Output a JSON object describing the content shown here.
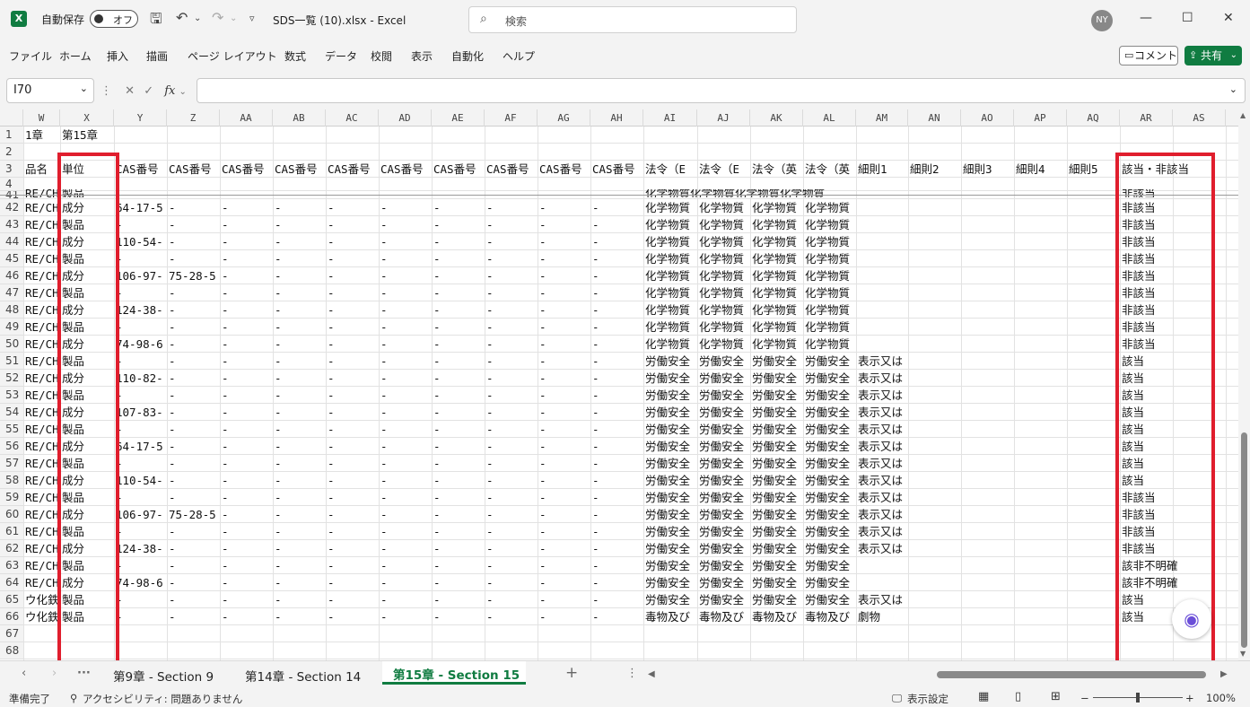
{
  "titlebar": {
    "app_icon": "X",
    "autosave_label": "自動保存",
    "autosave_state": "オフ",
    "doc_title": "SDS一覧 (10).xlsx  -  Excel",
    "search_placeholder": "検索",
    "avatar": "NY"
  },
  "ribbon": {
    "menu": [
      "ファイル",
      "ホーム",
      "挿入",
      "描画",
      "ページ レイアウト",
      "数式",
      "データ",
      "校閲",
      "表示",
      "自動化",
      "ヘルプ"
    ],
    "comment_label": "コメント",
    "share_label": "共有"
  },
  "formulabar": {
    "namebox": "I70",
    "fx": "fx",
    "value": ""
  },
  "grid": {
    "columns": [
      "W",
      "X",
      "Y",
      "Z",
      "AA",
      "AB",
      "AC",
      "AD",
      "AE",
      "AF",
      "AG",
      "AH",
      "AI",
      "AJ",
      "AK",
      "AL",
      "AM",
      "AN",
      "AO",
      "AP",
      "AQ",
      "AR",
      "AS"
    ],
    "row_numbers": [
      "1",
      "2",
      "3",
      "4",
      "41",
      "42",
      "43",
      "44",
      "45",
      "46",
      "47",
      "48",
      "49",
      "50",
      "51",
      "52",
      "53",
      "54",
      "55",
      "56",
      "57",
      "58",
      "59",
      "60",
      "61",
      "62",
      "63",
      "64",
      "65",
      "66",
      "67",
      "68"
    ],
    "row1": {
      "W": "1章",
      "X": "第15章"
    },
    "row3": [
      "品名",
      "単位",
      "CAS番号",
      "CAS番号",
      "CAS番号",
      "CAS番号",
      "CAS番号",
      "CAS番号",
      "CAS番号",
      "CAS番号",
      "CAS番号",
      "CAS番号",
      "法令（E",
      "法令（E",
      "法令（英",
      "法令（英",
      "細則1",
      "細則2",
      "細則3",
      "細則4",
      "細則5",
      "該当・非該当",
      ""
    ],
    "partial_row41": {
      "W": "RE/CH",
      "X": "製品",
      "AI": "化学物質化学物質化学物質化学物質",
      "AR": "非該当"
    },
    "rows": [
      {
        "W": "RE/CH",
        "X": "成分",
        "Y": "64-17-5",
        "Z": "-",
        "AI": "化学物質",
        "AJ": "化学物質",
        "AK": "化学物質",
        "AL": "化学物質",
        "AM": "",
        "AR": "非該当"
      },
      {
        "W": "RE/CH",
        "X": "製品",
        "Y": "-",
        "Z": "-",
        "AI": "化学物質",
        "AJ": "化学物質",
        "AK": "化学物質",
        "AL": "化学物質",
        "AM": "",
        "AR": "非該当"
      },
      {
        "W": "RE/CH",
        "X": "成分",
        "Y": "110-54-",
        "Z": "-",
        "AI": "化学物質",
        "AJ": "化学物質",
        "AK": "化学物質",
        "AL": "化学物質",
        "AM": "",
        "AR": "非該当"
      },
      {
        "W": "RE/CH",
        "X": "製品",
        "Y": "-",
        "Z": "-",
        "AI": "化学物質",
        "AJ": "化学物質",
        "AK": "化学物質",
        "AL": "化学物質",
        "AM": "",
        "AR": "非該当"
      },
      {
        "W": "RE/CH",
        "X": "成分",
        "Y": "106-97-",
        "Z": "75-28-5",
        "AI": "化学物質",
        "AJ": "化学物質",
        "AK": "化学物質",
        "AL": "化学物質",
        "AM": "",
        "AR": "非該当"
      },
      {
        "W": "RE/CH",
        "X": "製品",
        "Y": "-",
        "Z": "-",
        "AI": "化学物質",
        "AJ": "化学物質",
        "AK": "化学物質",
        "AL": "化学物質",
        "AM": "",
        "AR": "非該当"
      },
      {
        "W": "RE/CH",
        "X": "成分",
        "Y": "124-38-",
        "Z": "-",
        "AI": "化学物質",
        "AJ": "化学物質",
        "AK": "化学物質",
        "AL": "化学物質",
        "AM": "",
        "AR": "非該当"
      },
      {
        "W": "RE/CH",
        "X": "製品",
        "Y": "-",
        "Z": "-",
        "AI": "化学物質",
        "AJ": "化学物質",
        "AK": "化学物質",
        "AL": "化学物質",
        "AM": "",
        "AR": "非該当"
      },
      {
        "W": "RE/CH",
        "X": "成分",
        "Y": "74-98-6",
        "Z": "-",
        "AI": "化学物質",
        "AJ": "化学物質",
        "AK": "化学物質",
        "AL": "化学物質",
        "AM": "",
        "AR": "非該当"
      },
      {
        "W": "RE/CH",
        "X": "製品",
        "Y": "-",
        "Z": "-",
        "AI": "労働安全",
        "AJ": "労働安全",
        "AK": "労働安全",
        "AL": "労働安全",
        "AM": "表示又は",
        "AR": "該当"
      },
      {
        "W": "RE/CH",
        "X": "成分",
        "Y": "110-82-",
        "Z": "-",
        "AI": "労働安全",
        "AJ": "労働安全",
        "AK": "労働安全",
        "AL": "労働安全",
        "AM": "表示又は",
        "AR": "該当"
      },
      {
        "W": "RE/CH",
        "X": "製品",
        "Y": "-",
        "Z": "-",
        "AI": "労働安全",
        "AJ": "労働安全",
        "AK": "労働安全",
        "AL": "労働安全",
        "AM": "表示又は",
        "AR": "該当"
      },
      {
        "W": "RE/CH",
        "X": "成分",
        "Y": "107-83-",
        "Z": "-",
        "AI": "労働安全",
        "AJ": "労働安全",
        "AK": "労働安全",
        "AL": "労働安全",
        "AM": "表示又は",
        "AR": "該当"
      },
      {
        "W": "RE/CH",
        "X": "製品",
        "Y": "-",
        "Z": "-",
        "AI": "労働安全",
        "AJ": "労働安全",
        "AK": "労働安全",
        "AL": "労働安全",
        "AM": "表示又は",
        "AR": "該当"
      },
      {
        "W": "RE/CH",
        "X": "成分",
        "Y": "64-17-5",
        "Z": "-",
        "AI": "労働安全",
        "AJ": "労働安全",
        "AK": "労働安全",
        "AL": "労働安全",
        "AM": "表示又は",
        "AR": "該当"
      },
      {
        "W": "RE/CH",
        "X": "製品",
        "Y": "-",
        "Z": "-",
        "AI": "労働安全",
        "AJ": "労働安全",
        "AK": "労働安全",
        "AL": "労働安全",
        "AM": "表示又は",
        "AR": "該当"
      },
      {
        "W": "RE/CH",
        "X": "成分",
        "Y": "110-54-",
        "Z": "-",
        "AI": "労働安全",
        "AJ": "労働安全",
        "AK": "労働安全",
        "AL": "労働安全",
        "AM": "表示又は",
        "AR": "該当"
      },
      {
        "W": "RE/CH",
        "X": "製品",
        "Y": "-",
        "Z": "-",
        "AI": "労働安全",
        "AJ": "労働安全",
        "AK": "労働安全",
        "AL": "労働安全",
        "AM": "表示又は",
        "AR": "非該当"
      },
      {
        "W": "RE/CH",
        "X": "成分",
        "Y": "106-97-",
        "Z": "75-28-5",
        "AI": "労働安全",
        "AJ": "労働安全",
        "AK": "労働安全",
        "AL": "労働安全",
        "AM": "表示又は",
        "AR": "非該当"
      },
      {
        "W": "RE/CH",
        "X": "製品",
        "Y": "-",
        "Z": "-",
        "AI": "労働安全",
        "AJ": "労働安全",
        "AK": "労働安全",
        "AL": "労働安全",
        "AM": "表示又は",
        "AR": "非該当"
      },
      {
        "W": "RE/CH",
        "X": "成分",
        "Y": "124-38-",
        "Z": "-",
        "AI": "労働安全",
        "AJ": "労働安全",
        "AK": "労働安全",
        "AL": "労働安全",
        "AM": "表示又は",
        "AR": "非該当"
      },
      {
        "W": "RE/CH",
        "X": "製品",
        "Y": "-",
        "Z": "-",
        "AI": "労働安全",
        "AJ": "労働安全",
        "AK": "労働安全",
        "AL": "労働安全",
        "AM": "",
        "AR": "該非不明確"
      },
      {
        "W": "RE/CH",
        "X": "成分",
        "Y": "74-98-6",
        "Z": "-",
        "AI": "労働安全",
        "AJ": "労働安全",
        "AK": "労働安全",
        "AL": "労働安全",
        "AM": "",
        "AR": "該非不明確"
      },
      {
        "W": "ウ化鉄",
        "X": "製品",
        "Y": "-",
        "Z": "-",
        "AI": "労働安全",
        "AJ": "労働安全",
        "AK": "労働安全",
        "AL": "労働安全",
        "AM": "表示又は",
        "AR": "該当"
      },
      {
        "W": "ウ化鉄",
        "X": "製品",
        "Y": "-",
        "Z": "-",
        "AI": "毒物及び",
        "AJ": "毒物及び",
        "AK": "毒物及び",
        "AL": "毒物及び",
        "AM": "劇物",
        "AR": "該当"
      }
    ]
  },
  "sheettabs": {
    "more": "···",
    "tabs": [
      "第9章 - Section 9",
      "第14章 - Section 14",
      "第15章 - Section 15"
    ],
    "active_index": 2,
    "add": "+"
  },
  "statusbar": {
    "ready": "準備完了",
    "accessibility": "アクセシビリティ: 問題ありません",
    "display_settings": "表示設定",
    "zoom": "100%"
  },
  "colors": {
    "highlight": "#e01e2d",
    "accent": "#107c41"
  }
}
